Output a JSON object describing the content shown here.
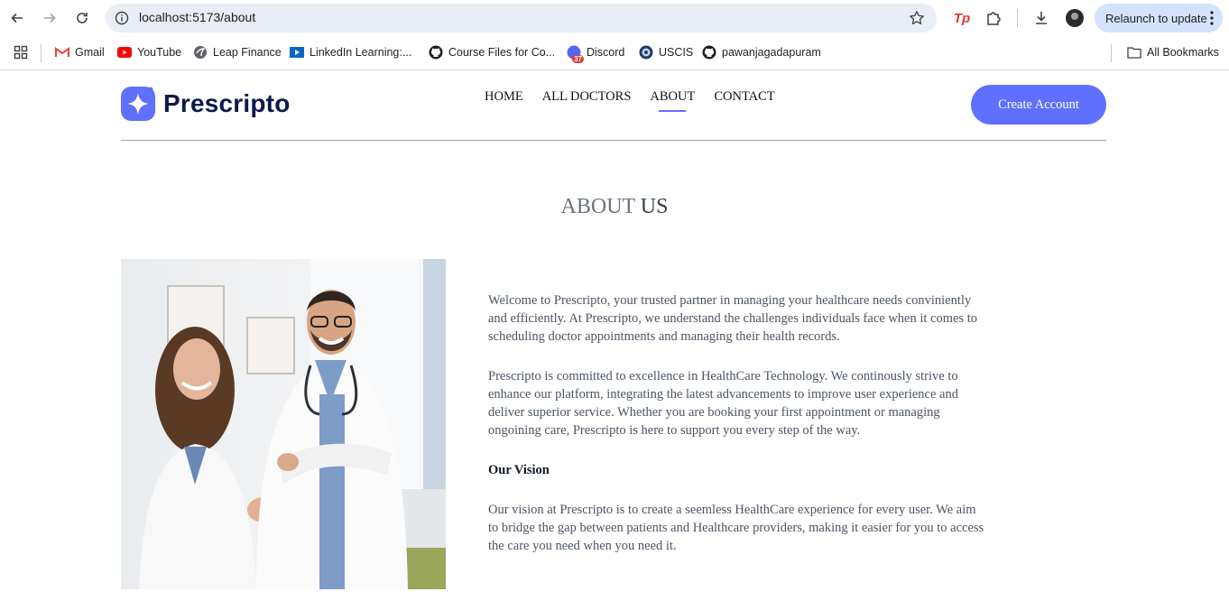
{
  "browser": {
    "url": "localhost:5173/about",
    "relaunch_label": "Relaunch to update",
    "tp_label": "Tp",
    "bookmarks": [
      {
        "label": "Gmail",
        "icon": "gmail-icon"
      },
      {
        "label": "YouTube",
        "icon": "youtube-icon"
      },
      {
        "label": "Leap Finance",
        "icon": "leap-finance-icon"
      },
      {
        "label": "LinkedIn Learning:...",
        "icon": "linkedin-learning-icon"
      },
      {
        "label": "Course Files for Co...",
        "icon": "github-icon"
      },
      {
        "label": "Discord",
        "icon": "discord-icon",
        "badge": "37"
      },
      {
        "label": "USCIS",
        "icon": "uscis-icon"
      },
      {
        "label": "pawanjagadapuram",
        "icon": "github-icon"
      }
    ],
    "all_bookmarks": "All Bookmarks"
  },
  "site": {
    "logo_text": "Prescripto",
    "nav": [
      "HOME",
      "ALL DOCTORS",
      "ABOUT",
      "CONTACT"
    ],
    "active_nav": "ABOUT",
    "cta": "Create Account",
    "accent": "#5f6fff"
  },
  "about": {
    "title_light": "ABOUT",
    "title_strong": "US",
    "image_alt": "Two smiling doctors in white coats",
    "paragraphs": [
      "Welcome to Prescripto, your trusted partner in managing your healthcare needs conviniently and efficiently. At Prescripto, we understand the challenges individuals face when it comes to scheduling doctor appointments and managing their health records.",
      "Prescripto is committed to excellence in HealthCare Technology. We continously strive to enhance our platform, integrating the latest advancements to improve user experience and deliver superior service. Whether you are booking your first appointment or managing ongoining care, Prescripto is here to support you every step of the way."
    ],
    "vision_heading": "Our Vision",
    "vision_text": "Our vision at Prescripto is to create a seemless HealthCare experience for every user. We aim to bridge the gap between patients and Healthcare providers, making it easier for you to access the care you need when you need it."
  }
}
